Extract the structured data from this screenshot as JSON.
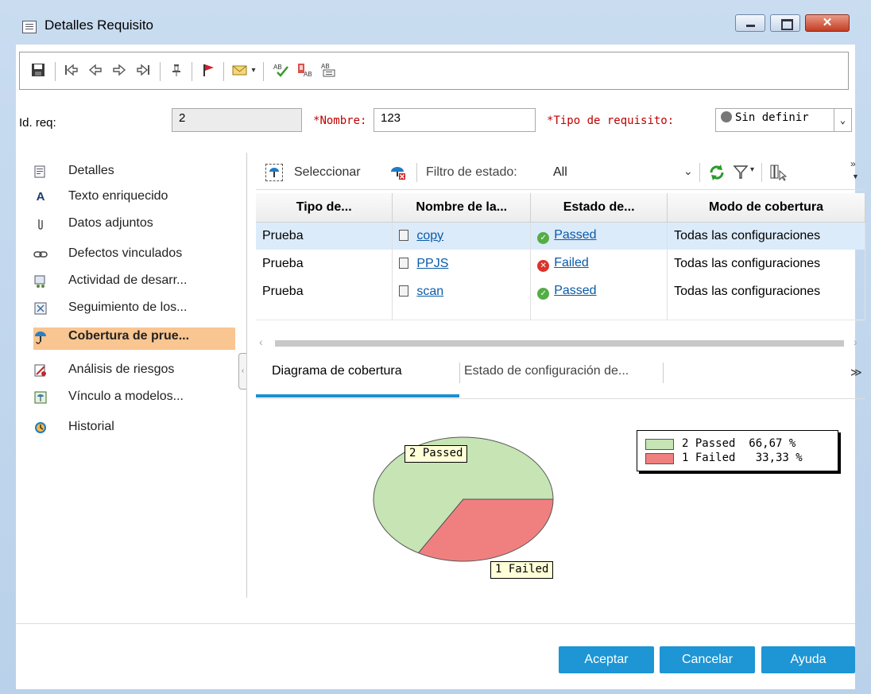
{
  "window": {
    "title": "Detalles Requisito",
    "close_glyph": "✕"
  },
  "toolbar": {
    "icons": [
      "save-icon",
      "first-record-icon",
      "previous-record-icon",
      "next-record-icon",
      "last-record-icon",
      "pin-icon",
      "flag-icon",
      "mail-icon",
      "spell-check-icon",
      "thesaurus-icon",
      "spelling-options-icon"
    ]
  },
  "form": {
    "id_label": "Id. req:",
    "id_value": "2",
    "name_label": "Nombre:",
    "name_value": "123",
    "type_label": "Tipo de requisito:",
    "type_value": "Sin definir",
    "required_mark": "*"
  },
  "sidebar": {
    "items": [
      {
        "label": "Detalles",
        "icon": "details-icon",
        "active": false
      },
      {
        "label": "Texto enriquecido",
        "icon": "rich-text-icon",
        "active": false
      },
      {
        "label": "Datos adjuntos",
        "icon": "attachment-icon",
        "active": false
      },
      {
        "label": "Defectos vinculados",
        "icon": "linked-defects-icon",
        "active": false
      },
      {
        "label": "Actividad de desarr...",
        "icon": "dev-activity-icon",
        "active": false
      },
      {
        "label": "Seguimiento de los...",
        "icon": "traceability-icon",
        "active": false
      },
      {
        "label": "Cobertura de prue...",
        "icon": "test-coverage-icon",
        "active": true
      },
      {
        "label": "Análisis de riesgos",
        "icon": "risk-analysis-icon",
        "active": false
      },
      {
        "label": "Vínculo a modelos...",
        "icon": "model-link-icon",
        "active": false
      },
      {
        "label": "Historial",
        "icon": "history-icon",
        "active": false
      }
    ]
  },
  "coverage_toolbar": {
    "select_label": "Seleccionar",
    "filter_label": "Filtro de estado:",
    "filter_value": "All",
    "more_glyph": "»"
  },
  "grid": {
    "columns": [
      "Tipo de...",
      "Nombre de la...",
      "Estado de...",
      "Modo de cobertura"
    ],
    "rows": [
      {
        "type": "Prueba",
        "name": "copy",
        "status": "Passed",
        "mode": "Todas las configuraciones",
        "selected": true
      },
      {
        "type": "Prueba",
        "name": "PPJS",
        "status": "Failed",
        "mode": "Todas las configuraciones",
        "selected": false
      },
      {
        "type": "Prueba",
        "name": "scan",
        "status": "Passed",
        "mode": "Todas las configuraciones",
        "selected": false
      }
    ]
  },
  "tabs": {
    "items": [
      "Diagrama de cobertura",
      "Estado de configuración de..."
    ],
    "active_index": 0,
    "expand_glyph": "≫"
  },
  "chart_data": {
    "type": "pie",
    "slices": [
      {
        "label": "2 Passed",
        "value": 2,
        "percent": "66,67 %",
        "color": "#c6e4b4"
      },
      {
        "label": "1 Failed",
        "value": 1,
        "percent": "33,33 %",
        "color": "#f08080"
      }
    ],
    "legend": [
      {
        "text": "2 Passed  66,67 %",
        "color": "#c6e4b4"
      },
      {
        "text": "1 Failed   33,33 %",
        "color": "#f08080"
      }
    ],
    "legend_position": "top-right"
  },
  "buttons": {
    "accept": "Aceptar",
    "cancel": "Cancelar",
    "help": "Ayuda"
  },
  "colors": {
    "accent": "#1e95d4",
    "active_sidebar": "#f9c590",
    "selected_row": "#dcebfa",
    "required": "#c00000"
  }
}
